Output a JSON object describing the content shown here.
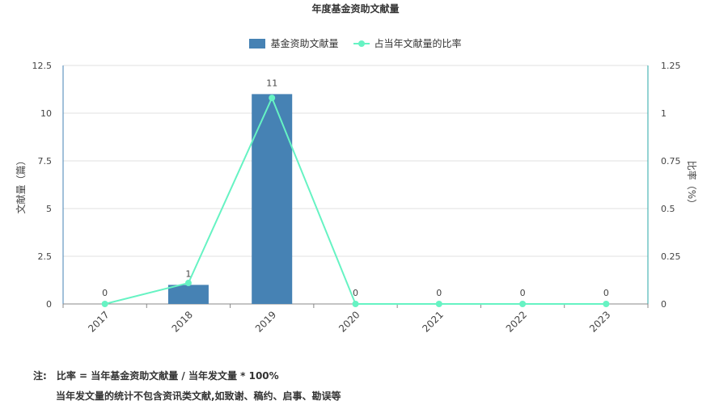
{
  "chart_data": {
    "type": "bar",
    "title": "年度基金资助文献量",
    "categories": [
      "2017",
      "2018",
      "2019",
      "2020",
      "2021",
      "2022",
      "2023"
    ],
    "series": [
      {
        "name": "基金资助文献量",
        "type": "bar",
        "axis": "left",
        "values": [
          0,
          1,
          11,
          0,
          0,
          0,
          0
        ],
        "color": "#4682b4"
      },
      {
        "name": "占当年文献量的比率",
        "type": "line",
        "axis": "right",
        "values": [
          0,
          0.11,
          1.08,
          0,
          0,
          0,
          0
        ],
        "color": "#66f3c3"
      }
    ],
    "bar_labels": [
      "0",
      "1",
      "11",
      "0",
      "0",
      "0",
      "0"
    ],
    "ylabel": "文献量（篇）",
    "ylabel_right": "比率（%）",
    "ylim": [
      0,
      12.5
    ],
    "ylim_right": [
      0,
      1.25
    ],
    "yticks": [
      "0",
      "2.5",
      "5",
      "7.5",
      "10",
      "12.5"
    ],
    "yticks_right": [
      "0",
      "0.25",
      "0.5",
      "0.75",
      "1",
      "1.25"
    ],
    "grid": true,
    "legend_position": "top-center"
  },
  "notes": {
    "label": "注:",
    "line1": "比率 = 当年基金资助文献量 / 当年发文量 * 100%",
    "line2": "当年发文量的统计不包含资讯类文献,如致谢、稿约、启事、勘误等"
  }
}
